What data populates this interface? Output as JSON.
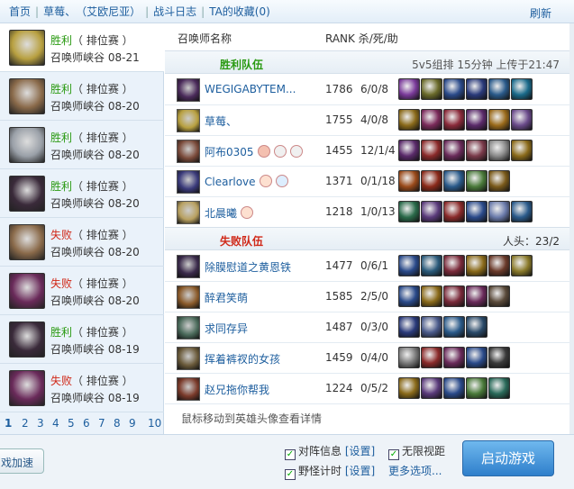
{
  "topbar": {
    "home": "首页",
    "player": "草莓、",
    "server": "（艾欧尼亚）",
    "log": "战斗日志",
    "fav": "TA的收藏(0)",
    "refresh": "刷新"
  },
  "games": [
    {
      "result": "胜利",
      "mode": "（ 排位赛 ）",
      "map": "召唤师峡谷",
      "date": "08-21",
      "win": true,
      "color": "#b8a040"
    },
    {
      "result": "胜利",
      "mode": "（ 排位赛 ）",
      "map": "召唤师峡谷",
      "date": "08-20",
      "win": true,
      "color": "#8a6a4a"
    },
    {
      "result": "胜利",
      "mode": "（ 排位赛 ）",
      "map": "召唤师峡谷",
      "date": "08-20",
      "win": true,
      "color": "#9aa0a8"
    },
    {
      "result": "胜利",
      "mode": "（ 排位赛 ）",
      "map": "召唤师峡谷",
      "date": "08-20",
      "win": true,
      "color": "#3a2a3a"
    },
    {
      "result": "失败",
      "mode": "（ 排位赛 ）",
      "map": "召唤师峡谷",
      "date": "08-20",
      "win": false,
      "color": "#8a6a4a"
    },
    {
      "result": "失败",
      "mode": "（ 排位赛 ）",
      "map": "召唤师峡谷",
      "date": "08-20",
      "win": false,
      "color": "#6a2a5a"
    },
    {
      "result": "胜利",
      "mode": "（ 排位赛 ）",
      "map": "召唤师峡谷",
      "date": "08-19",
      "win": true,
      "color": "#3a2a3a"
    },
    {
      "result": "失败",
      "mode": "（ 排位赛 ）",
      "map": "召唤师峡谷",
      "date": "08-19",
      "win": false,
      "color": "#6a2a5a"
    }
  ],
  "pages": [
    "1",
    "2",
    "3",
    "4",
    "5",
    "6",
    "7",
    "8",
    "9",
    "10"
  ],
  "header": {
    "name": "召唤师名称",
    "rank": "RANK 杀/死/助"
  },
  "win_team": {
    "title": "胜利队伍",
    "info": "5v5组排 15分钟 上传于21:47"
  },
  "lose_team": {
    "title": "失败队伍",
    "heads": "人头：23/2"
  },
  "win_players": [
    {
      "name": "WEGIGABYTEM...",
      "rank": "1786",
      "kda": "6/0/8",
      "color": "#4a2a5a",
      "items": [
        "#7a3a9a",
        "#6a6a2a",
        "#2a4a8a",
        "#2a3a7a",
        "#2a5a8a",
        "#1a6a8a"
      ]
    },
    {
      "name": "草莓、",
      "rank": "1755",
      "kda": "4/0/8",
      "color": "#b8a040",
      "items": [
        "#8a6a1a",
        "#7a2a5a",
        "#8a2a3a",
        "#5a2a6a",
        "#9a6a1a",
        "#6a4a8a"
      ]
    },
    {
      "name": "阿布0305",
      "rank": "1455",
      "kda": "12/1/4",
      "color": "#7a4a3a",
      "items": [
        "#5a2a6a",
        "#8a2a2a",
        "#6a2a5a",
        "#7a3a4a",
        "#8a8a8a",
        "#8a6a1a"
      ]
    },
    {
      "name": "Clearlove",
      "rank": "1371",
      "kda": "0/1/18",
      "color": "#3a3a7a",
      "items": [
        "#9a4a1a",
        "#8a2a1a",
        "#2a5a8a",
        "#4a7a3a",
        "#7a5a1a"
      ]
    },
    {
      "name": "北晨曦",
      "rank": "1218",
      "kda": "1/0/13",
      "color": "#b8a060",
      "items": [
        "#2a6a4a",
        "#5a3a7a",
        "#8a2a2a",
        "#2a4a8a",
        "#6a7aaa",
        "#2a5a8a"
      ]
    }
  ],
  "lose_players": [
    {
      "name": "除膜慰道之黄恩铁",
      "rank": "1477",
      "kda": "0/6/1",
      "color": "#3a2a4a",
      "items": [
        "#2a4a8a",
        "#2a5a7a",
        "#7a2a3a",
        "#8a6a1a",
        "#6a3a2a",
        "#8a7a2a"
      ]
    },
    {
      "name": "醉君笑萌",
      "rank": "1585",
      "kda": "2/5/0",
      "color": "#8a5a2a",
      "items": [
        "#2a4a8a",
        "#8a6a1a",
        "#7a2a3a",
        "#6a2a5a",
        "#5a4a3a"
      ]
    },
    {
      "name": "求同存异",
      "rank": "1487",
      "kda": "0/3/0",
      "color": "#4a6a5a",
      "items": [
        "#2a3a7a",
        "#4a5a8a",
        "#2a5a8a",
        "#2a4a6a"
      ]
    },
    {
      "name": "挥着裤衩的女孩",
      "rank": "1459",
      "kda": "0/4/0",
      "color": "#6a5a3a",
      "items": [
        "#7a7a7a",
        "#8a2a2a",
        "#6a2a5a",
        "#2a4a8a",
        "#3a3a3a"
      ]
    },
    {
      "name": "赵兄拖你帮我",
      "rank": "1224",
      "kda": "0/5/2",
      "color": "#7a3a2a",
      "items": [
        "#8a6a1a",
        "#5a3a7a",
        "#2a4a8a",
        "#4a7a3a",
        "#2a6a5a"
      ]
    }
  ],
  "hint": "鼠标移动到英雄头像查看详情",
  "bottom": {
    "accel": "戏加速",
    "lineup": "对阵信息",
    "lineup_set": "[设置]",
    "vision": "无限视距",
    "jungle": "野怪计时",
    "jungle_set": "[设置]",
    "more": "更多选项...",
    "launch": "启动游戏"
  }
}
